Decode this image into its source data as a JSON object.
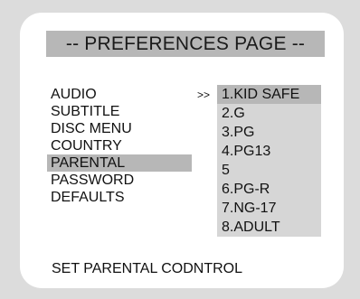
{
  "page": {
    "title": "-- PREFERENCES PAGE --",
    "status_text": "SET PARENTAL CODNTROL"
  },
  "menu": {
    "items": [
      {
        "label": "AUDIO"
      },
      {
        "label": "SUBTITLE"
      },
      {
        "label": "DISC MENU"
      },
      {
        "label": "COUNTRY"
      },
      {
        "label": "PARENTAL",
        "selected": true
      },
      {
        "label": "PASSWORD"
      },
      {
        "label": "DEFAULTS"
      }
    ]
  },
  "submenu": {
    "pointer": ">>",
    "items": [
      {
        "label": "1.KID SAFE",
        "highlighted": true
      },
      {
        "label": "2.G"
      },
      {
        "label": "3.PG"
      },
      {
        "label": "4.PG13"
      },
      {
        "label": "5"
      },
      {
        "label": "6.PG-R"
      },
      {
        "label": "7.NG-17"
      },
      {
        "label": "8.ADULT"
      }
    ]
  },
  "colors": {
    "background": "#dcdcdc",
    "panel": "#ffffff",
    "highlight": "#b7b7b7",
    "submenu_bg": "#d6d6d6"
  }
}
